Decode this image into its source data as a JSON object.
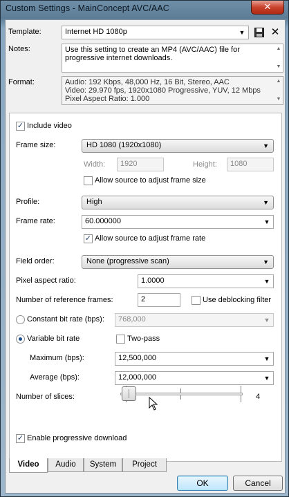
{
  "window": {
    "title": "Custom Settings - MainConcept AVC/AAC",
    "close_glyph": "✕"
  },
  "header": {
    "template_label": "Template:",
    "template_value": "Internet HD 1080p",
    "save_icon": "floppy-disk-icon",
    "delete_icon": "delete-x-icon",
    "notes_label": "Notes:",
    "notes_lines": [
      "Use this setting to create an MP4 (AVC/AAC) file for",
      "progressive internet downloads."
    ],
    "format_label": "Format:",
    "format_lines": [
      "Audio: 192 Kbps, 48,000 Hz, 16 Bit, Stereo, AAC",
      "Video: 29.970 fps, 1920x1080 Progressive, YUV, 12 Mbps",
      "Pixel Aspect Ratio: 1.000"
    ]
  },
  "video": {
    "include_video": {
      "label": "Include video",
      "checked": true
    },
    "frame_size": {
      "label": "Frame size:",
      "value": "HD 1080 (1920x1080)"
    },
    "width": {
      "label": "Width:",
      "value": "1920"
    },
    "height": {
      "label": "Height:",
      "value": "1080"
    },
    "allow_frame_size": {
      "label": "Allow source to adjust frame size",
      "checked": false
    },
    "profile": {
      "label": "Profile:",
      "value": "High"
    },
    "frame_rate": {
      "label": "Frame rate:",
      "value": "60.000000"
    },
    "allow_frame_rate": {
      "label": "Allow source to adjust frame rate",
      "checked": true
    },
    "field_order": {
      "label": "Field order:",
      "value": "None (progressive scan)"
    },
    "pixel_aspect": {
      "label": "Pixel aspect ratio:",
      "value": "1.0000"
    },
    "ref_frames": {
      "label": "Number of reference frames:",
      "value": "2"
    },
    "deblocking": {
      "label": "Use deblocking filter",
      "checked": false
    },
    "cbr": {
      "label": "Constant bit rate (bps):",
      "value": "768,000",
      "selected": false
    },
    "vbr": {
      "label": "Variable bit rate",
      "selected": true
    },
    "two_pass": {
      "label": "Two-pass",
      "checked": false
    },
    "maximum": {
      "label": "Maximum (bps):",
      "value": "12,500,000"
    },
    "average": {
      "label": "Average (bps):",
      "value": "12,000,000"
    },
    "slices": {
      "label": "Number of slices:",
      "value_text": "4",
      "value": 1
    },
    "progressive_download": {
      "label": "Enable progressive download",
      "checked": true
    }
  },
  "tabs": [
    {
      "label": "Video",
      "active": true
    },
    {
      "label": "Audio",
      "active": false
    },
    {
      "label": "System",
      "active": false
    },
    {
      "label": "Project",
      "active": false
    }
  ],
  "buttons": {
    "ok": "OK",
    "cancel": "Cancel"
  },
  "glyphs": {
    "check": "✓",
    "down": "▼"
  }
}
